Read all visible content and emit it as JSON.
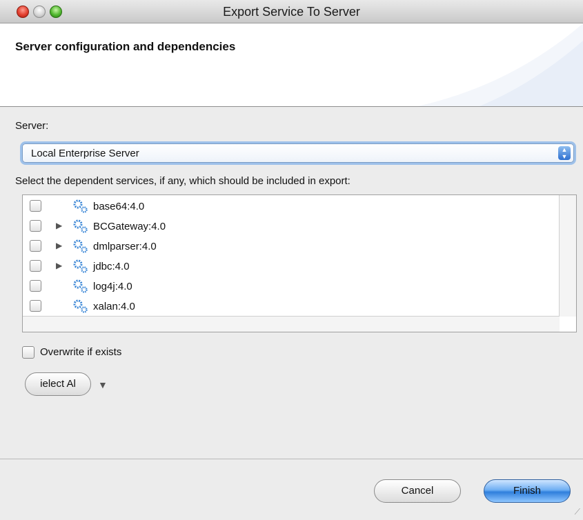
{
  "window": {
    "title": "Export Service To Server"
  },
  "header": {
    "title": "Server configuration and dependencies"
  },
  "server": {
    "label": "Server:",
    "selected": "Local Enterprise Server"
  },
  "dependencies": {
    "label": "Select the dependent services, if any, which should be included in export:",
    "items": [
      {
        "label": "base64:4.0",
        "checked": false,
        "expandable": false
      },
      {
        "label": "BCGateway:4.0",
        "checked": false,
        "expandable": true
      },
      {
        "label": "dmlparser:4.0",
        "checked": false,
        "expandable": true
      },
      {
        "label": "jdbc:4.0",
        "checked": false,
        "expandable": true
      },
      {
        "label": "log4j:4.0",
        "checked": false,
        "expandable": false
      },
      {
        "label": "xalan:4.0",
        "checked": false,
        "expandable": false
      }
    ]
  },
  "overwrite": {
    "label": "Overwrite if exists",
    "checked": false
  },
  "select_all": {
    "label": "ielect Al"
  },
  "footer": {
    "cancel_label": "Cancel",
    "finish_label": "Finish"
  }
}
